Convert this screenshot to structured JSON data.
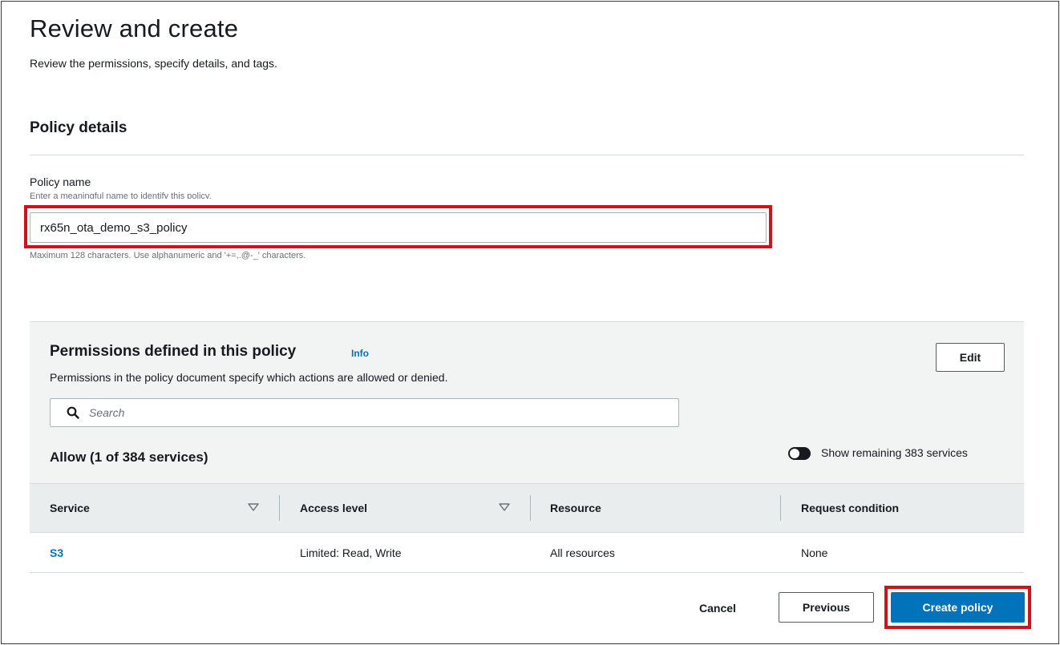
{
  "header": {
    "title": "Review and create",
    "description": "Review the permissions, specify details, and tags."
  },
  "policy_details": {
    "title": "Policy details",
    "name_label": "Policy name",
    "name_description": "Enter a meaningful name to identify this policy.",
    "name_value": "rx65n_ota_demo_s3_policy",
    "name_hint": "Maximum 128 characters. Use alphanumeric and '+=,.@-_' characters."
  },
  "permissions": {
    "title": "Permissions defined in this policy",
    "info_label": "Info",
    "description": "Permissions in the policy document specify which actions are allowed or denied.",
    "edit_label": "Edit",
    "search_placeholder": "Search",
    "allow_heading": "Allow (1 of 384 services)",
    "toggle_label": "Show remaining 383 services",
    "toggle_on": false,
    "columns": [
      "Service",
      "Access level",
      "Resource",
      "Request condition"
    ],
    "rows": [
      {
        "service": "S3",
        "access_level": "Limited: Read, Write",
        "resource": "All resources",
        "request_condition": "None"
      }
    ]
  },
  "footer": {
    "cancel_label": "Cancel",
    "previous_label": "Previous",
    "create_label": "Create policy"
  },
  "colors": {
    "primary": "#0073bb",
    "highlight": "#d0121b",
    "panel_bg": "#f2f3f3"
  },
  "icons": [
    "search-icon",
    "sort-icon",
    "toggle-switch"
  ]
}
